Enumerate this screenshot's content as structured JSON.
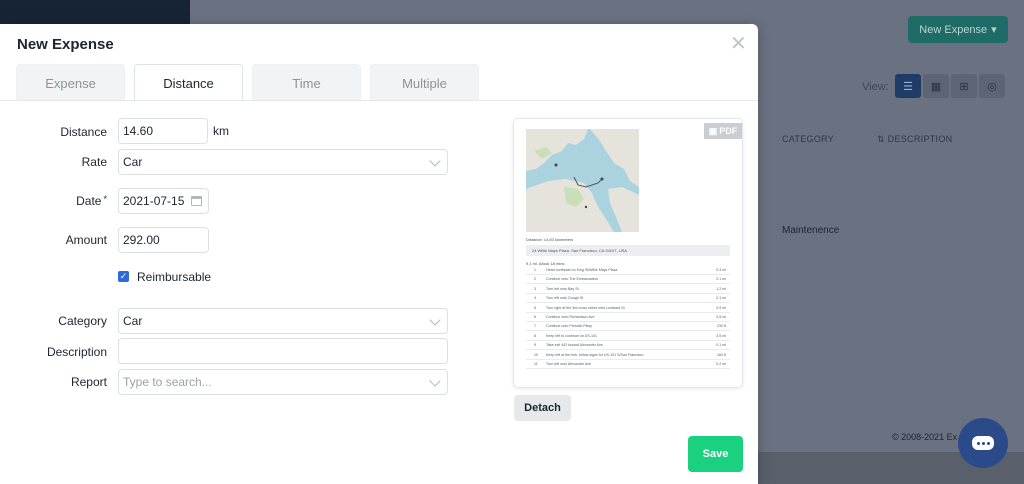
{
  "background": {
    "new_expense_label": "New Expense",
    "view_label": "View:",
    "columns": {
      "category": "CATEGORY",
      "description": "DESCRIPTION"
    },
    "row_category": "Maintenence",
    "copyright": "© 2008-2021 Ex"
  },
  "modal": {
    "title": "New Expense",
    "tabs": [
      {
        "label": "Expense",
        "active": false
      },
      {
        "label": "Distance",
        "active": true
      },
      {
        "label": "Time",
        "active": false
      },
      {
        "label": "Multiple",
        "active": false
      }
    ],
    "fields": {
      "distance": {
        "label": "Distance",
        "value": "14.60",
        "unit": "km"
      },
      "rate": {
        "label": "Rate",
        "value": "Car"
      },
      "date": {
        "label": "Date",
        "required_mark": "*",
        "value": "2021-07-15"
      },
      "amount": {
        "label": "Amount",
        "value": "292.00"
      },
      "reimbursable": {
        "label": "Reimbursable",
        "checked": true
      },
      "category": {
        "label": "Category",
        "value": "Car"
      },
      "description": {
        "label": "Description",
        "value": ""
      },
      "report": {
        "label": "Report",
        "placeholder": "Type to search..."
      }
    },
    "receipt": {
      "pdf_tag": "PDF",
      "distance_line": "Distance: 14.60 kilometers",
      "address": "24 Willie Mays Plaza, San Francisco, CA 94107, USA",
      "route_header": "9.1 mi. About 18 mins",
      "steps": [
        {
          "n": "1",
          "text": "Head northeast on King St/Willie Mays Plaza",
          "dist": "0.3 mi"
        },
        {
          "n": "2",
          "text": "Continue onto The Embarcadero",
          "dist": "2.1 mi"
        },
        {
          "n": "3",
          "text": "Turn left onto Bay St",
          "dist": "1.2 mi"
        },
        {
          "n": "4",
          "text": "Turn left onto Gough St",
          "dist": "0.1 mi"
        },
        {
          "n": "5",
          "text": "Turn right at the 3rd cross street onto Lombard St",
          "dist": "0.9 mi"
        },
        {
          "n": "6",
          "text": "Continue onto Richardson Ave",
          "dist": "0.5 mi"
        },
        {
          "n": "7",
          "text": "Continue onto Presidio Pkwy",
          "dist": "230 ft"
        },
        {
          "n": "8",
          "text": "Keep left to continue on US-101",
          "dist": "3.5 mi"
        },
        {
          "n": "9",
          "text": "Take exit 442 toward Alexander Ave",
          "dist": "0.1 mi"
        },
        {
          "n": "10",
          "text": "Keep left at the fork, follow signs for US-101 S/San Francisco",
          "dist": "164 ft"
        },
        {
          "n": "11",
          "text": "Turn left onto Alexander Ave",
          "dist": "0.2 mi"
        }
      ]
    },
    "detach_label": "Detach",
    "save_label": "Save"
  }
}
